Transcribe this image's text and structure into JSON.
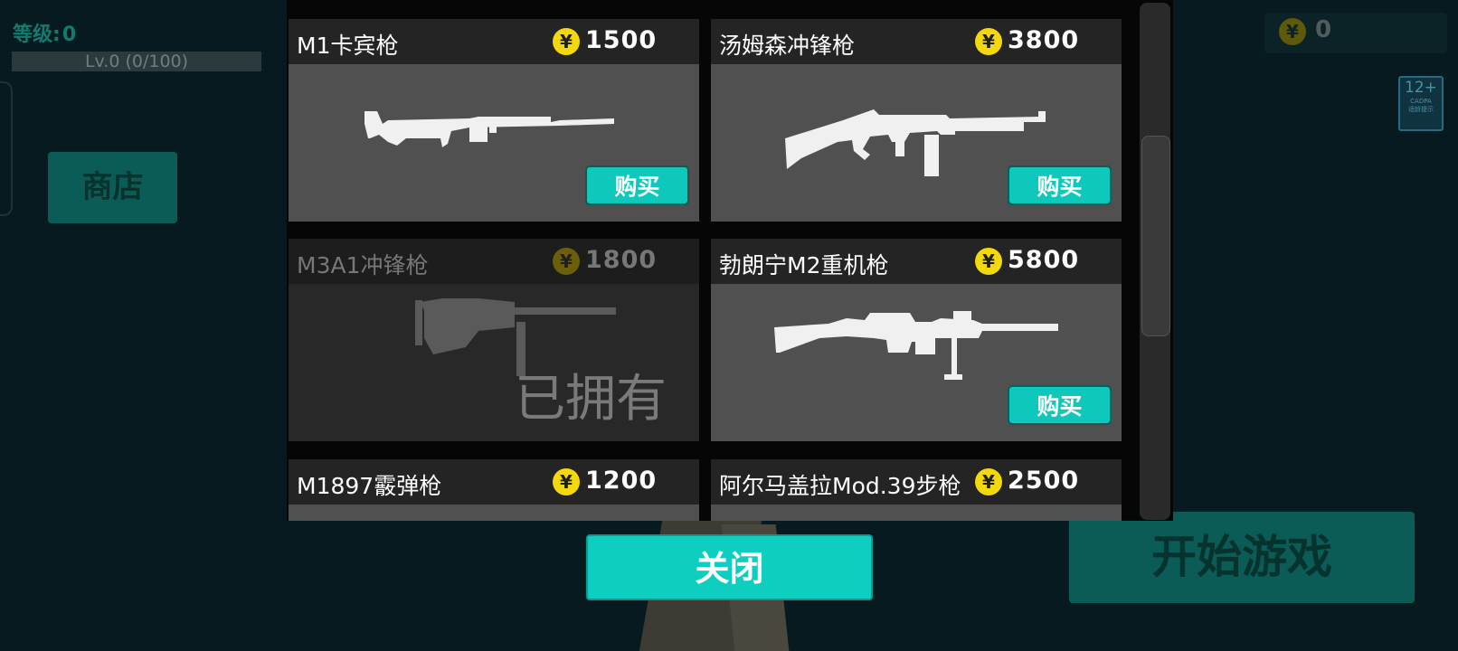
{
  "background": {
    "level_label": "等级:",
    "level_value": "0",
    "exp_text": "Lv.0 (0/100)",
    "shop_button": "商店",
    "coin_symbol": "¥",
    "coins": "0",
    "age_rating": "12+",
    "age_org": "CADPA",
    "age_note": "适龄提示",
    "start_button": "开始游戏"
  },
  "shop": {
    "coin_symbol": "¥",
    "buy_label": "购买",
    "owned_label": "已拥有",
    "items": [
      {
        "name": "M1卡宾枪",
        "price": "1500",
        "owned": false
      },
      {
        "name": "汤姆森冲锋枪",
        "price": "3800",
        "owned": false
      },
      {
        "name": "M3A1冲锋枪",
        "price": "1800",
        "owned": true
      },
      {
        "name": "勃朗宁M2重机枪",
        "price": "5800",
        "owned": false
      },
      {
        "name": "M1897霰弹枪",
        "price": "1200",
        "owned": false
      },
      {
        "name": "阿尔马盖拉Mod.39步枪",
        "price": "2500",
        "owned": false
      }
    ],
    "close_button": "关闭"
  },
  "colors": {
    "accent": "#0ec9bb",
    "coin": "#f4d80e",
    "background": "#061a20"
  }
}
